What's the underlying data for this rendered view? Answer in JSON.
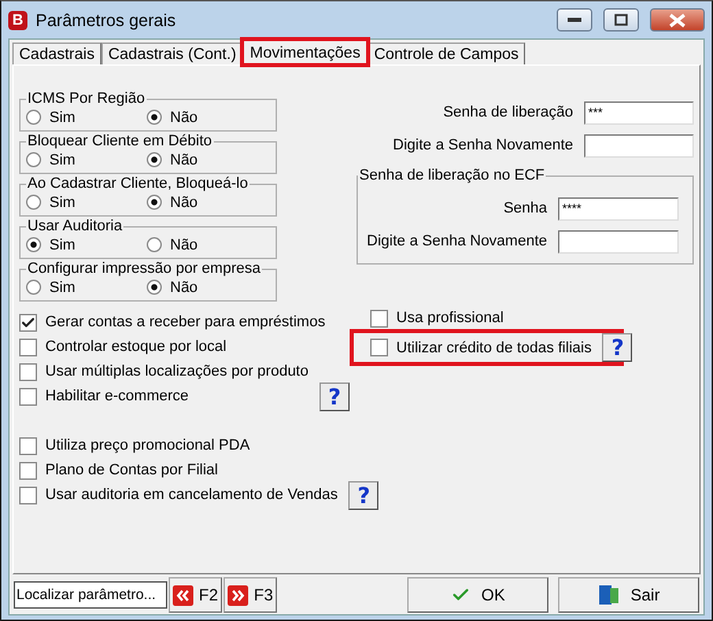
{
  "window": {
    "title": "Parâmetros gerais",
    "app_icon_letter": "B"
  },
  "tabs": [
    {
      "label": "Cadastrais",
      "selected": false,
      "highlighted": false
    },
    {
      "label": "Cadastrais (Cont.)",
      "selected": false,
      "highlighted": false
    },
    {
      "label": "Movimentações",
      "selected": true,
      "highlighted": true
    },
    {
      "label": "Controle de Campos",
      "selected": false,
      "highlighted": false
    }
  ],
  "radio_groups": [
    {
      "title": "ICMS Por Região",
      "options": [
        {
          "label": "Sim",
          "selected": false
        },
        {
          "label": "Não",
          "selected": true
        }
      ]
    },
    {
      "title": "Bloquear Cliente em Débito",
      "options": [
        {
          "label": "Sim",
          "selected": false
        },
        {
          "label": "Não",
          "selected": true
        }
      ]
    },
    {
      "title": "Ao Cadastrar Cliente, Bloqueá-lo",
      "options": [
        {
          "label": "Sim",
          "selected": false
        },
        {
          "label": "Não",
          "selected": true
        }
      ]
    },
    {
      "title": "Usar Auditoria",
      "options": [
        {
          "label": "Sim",
          "selected": true
        },
        {
          "label": "Não",
          "selected": false
        }
      ]
    },
    {
      "title": "Configurar impressão por empresa",
      "options": [
        {
          "label": "Sim",
          "selected": false
        },
        {
          "label": "Não",
          "selected": true
        }
      ]
    }
  ],
  "password_fields": [
    {
      "label": "Senha de liberação",
      "value": "***"
    },
    {
      "label": "Digite a Senha Novamente"
    }
  ],
  "ecf_group": {
    "title": "Senha de liberação no ECF",
    "fields": [
      {
        "label": "Senha",
        "value": "****"
      },
      {
        "label": "Digite a Senha Novamente"
      }
    ]
  },
  "options_left": [
    {
      "label": "Gerar contas a receber para empréstimos",
      "checked": true
    },
    {
      "label": "Controlar estoque por local",
      "checked": false
    },
    {
      "label": "Usar múltiplas localizações por produto",
      "checked": false
    },
    {
      "label": "Habilitar e-commerce",
      "checked": false,
      "help": "?"
    }
  ],
  "options_right": [
    {
      "label": "Usa profissional",
      "checked": false,
      "highlighted": false
    },
    {
      "label": "Utilizar crédito de todas filiais",
      "checked": false,
      "highlighted": true,
      "help": "?"
    }
  ],
  "options_bottom": [
    {
      "label": "Utiliza preço promocional PDA",
      "checked": false
    },
    {
      "label": "Plano de Contas por Filial",
      "checked": false
    },
    {
      "label": "Usar auditoria em cancelamento de Vendas",
      "checked": false,
      "help": "?"
    }
  ],
  "footer": {
    "search": {
      "placeholder": "Localizar parâmetro..."
    },
    "prev_button": "F2",
    "next_button": "F3",
    "ok_button": "OK",
    "exit_button": "Sair"
  }
}
